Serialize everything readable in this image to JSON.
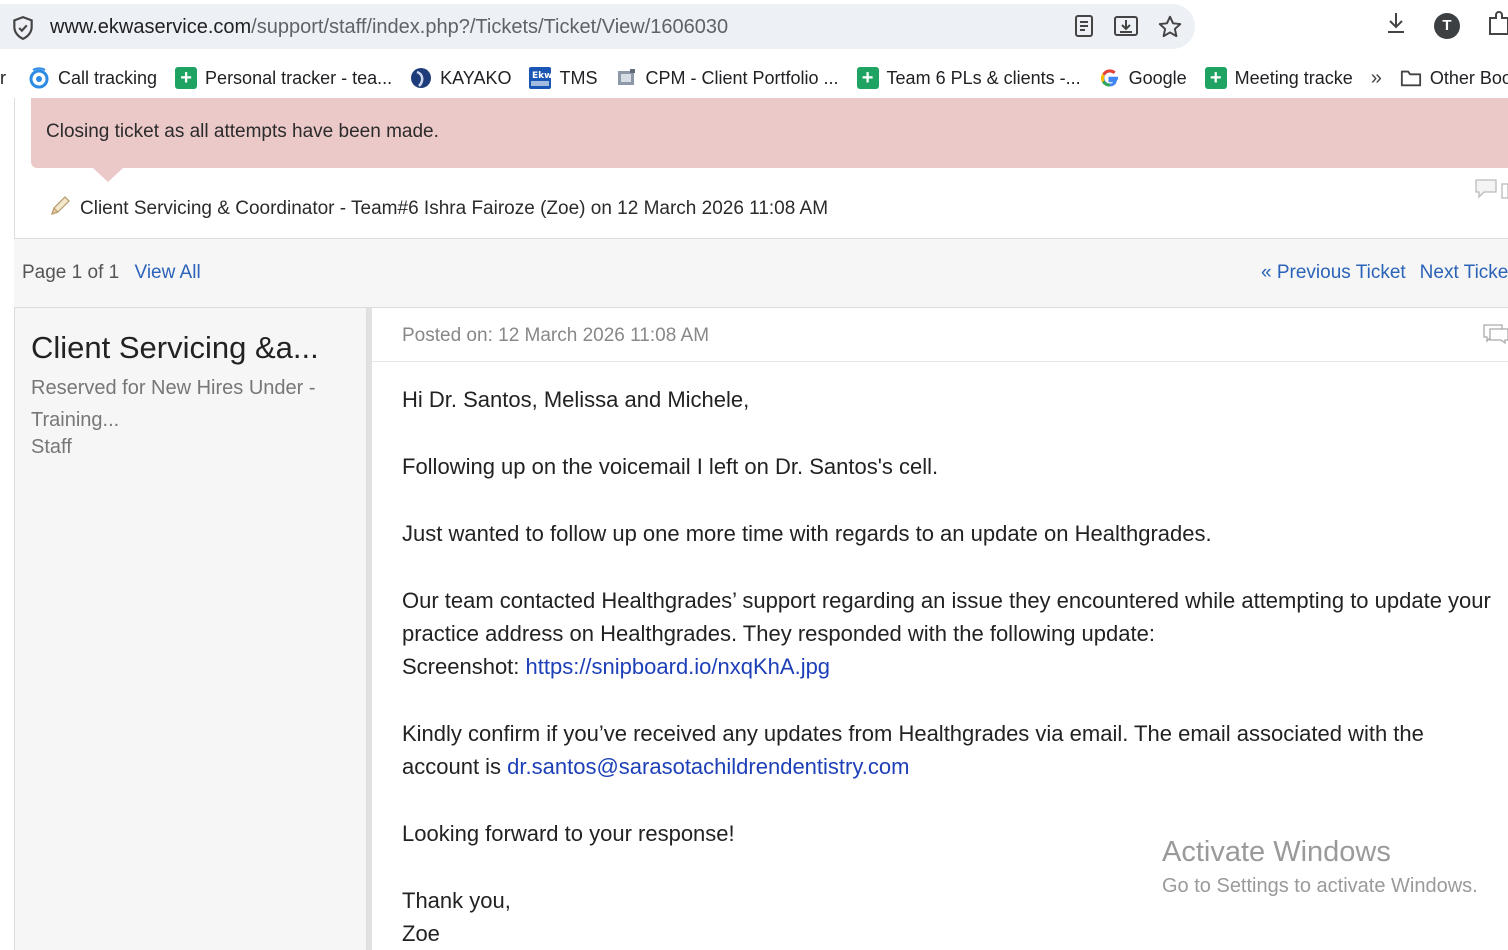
{
  "browser": {
    "url_host": "www.ekwaservice.com",
    "url_path": "/support/staff/index.php?/Tickets/Ticket/View/1606030",
    "avatar_letter": "T",
    "bookmarks": [
      {
        "label": "Call tracking",
        "icon": "call-tracking-icon"
      },
      {
        "label": "Personal tracker - tea...",
        "icon": "sheets-icon"
      },
      {
        "label": "KAYAKO",
        "icon": "kayako-icon"
      },
      {
        "label": "TMS",
        "icon": "tms-icon"
      },
      {
        "label": "CPM - Client Portfolio ...",
        "icon": "cpm-icon"
      },
      {
        "label": "Team 6 PLs & clients -...",
        "icon": "sheets-icon"
      },
      {
        "label": "Google",
        "icon": "google-icon"
      },
      {
        "label": "Meeting tracke",
        "icon": "sheets-icon"
      }
    ],
    "more_label": "»",
    "other_bookmarks": "Other Boo",
    "clipped_left": "r"
  },
  "note": {
    "text": "Closing ticket as all attempts have been made.",
    "meta": "Client Servicing & Coordinator - Team#6 Ishra Fairoze (Zoe) on 12 March 2026 11:08 AM"
  },
  "pager": {
    "page_text": "Page 1 of 1",
    "view_all": "View All",
    "previous": "« Previous Ticket",
    "next": "Next Ticke"
  },
  "post": {
    "author": "Client Servicing &a...",
    "role": "Reserved for New Hires Under - Training...",
    "type": "Staff",
    "posted_on": "Posted on: 12 March 2026 11:08 AM",
    "greeting": "Hi Dr. Santos, Melissa and Michele,",
    "p1": "Following up on the voicemail I left on Dr. Santos's cell.",
    "p2": "Just wanted to follow up one more time with regards to an update on Healthgrades.",
    "p3": "Our team contacted Healthgrades’ support regarding an issue they encountered while attempting to update your practice address on Healthgrades. They responded with the following update:",
    "screenshot_label": "Screenshot: ",
    "screenshot_link": "https://snipboard.io/nxqKhA.jpg",
    "p4": "Kindly confirm if you’ve received any updates from Healthgrades via email. The email associated with the account is ",
    "email": "dr.santos@sarasotachildrendentistry.com",
    "p5": "Looking forward to your response!",
    "closing": "Thank you,",
    "signature": "Zoe"
  },
  "watermark": {
    "title": "Activate Windows",
    "subtitle": "Go to Settings to activate Windows."
  }
}
